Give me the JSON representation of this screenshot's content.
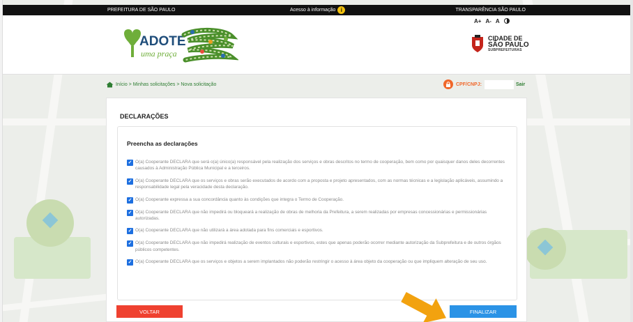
{
  "topbar": {
    "left": "PREFEITURA DE SÃO PAULO",
    "center": "Acesso à informação",
    "right": "TRANSPARÊNCIA SÃO PAULO"
  },
  "header": {
    "brand_main": "ADOTE",
    "brand_sub": "uma praça",
    "font_controls": [
      "A+",
      "A-",
      "A"
    ],
    "city_line1": "CIDADE DE",
    "city_line2": "SÃO PAULO",
    "city_line3": "SUBPREFEITURAS"
  },
  "breadcrumb": {
    "text": "Início > Minhas solicitações > Nova solicitação",
    "cpf_label": "CPF/CNPJ:",
    "cpf_value": "",
    "logout": "Sair"
  },
  "card": {
    "title": "DECLARAÇÕES",
    "section_heading": "Preencha as declarações",
    "declarations": [
      {
        "text": "O(a) Cooperante DECLARA que será o(a) único(a) responsável pela realização dos serviços e obras descritos no termo de cooperação, bem como por quaisquer danos deles decorrentes causados à Administração Pública Municipal e a terceiros.",
        "checked": true
      },
      {
        "text": "O(a) Cooperante DECLARA que os serviços e obras serão executados de acordo com a proposta e projeto apresentados, com as normas técnicas e a legislação aplicáveis, assumindo a responsabilidade legal pela veracidade desta declaração.",
        "checked": true
      },
      {
        "text": "O(a) Cooperante expressa a sua concordância quanto às condições que integra o Termo de Cooperação.",
        "checked": true
      },
      {
        "text": "O(a) Cooperante DECLARA que não impedirá ou bloqueará a realização de obras de melhoria da Prefeitura, a serem realizadas por empresas concessionárias e permissionárias autorizadas.",
        "checked": true
      },
      {
        "text": "O(a) Cooperante DECLARA que não utilizará a área adotada para fins comerciais e esportivos.",
        "checked": true
      },
      {
        "text": "O(a) Cooperante DECLARA que não impedirá realização de eventos culturais e esportivos, estes que apenas poderão ocorrer mediante autorização da Subprefeitura e de outros órgãos públicos competentes.",
        "checked": true
      },
      {
        "text": "O(a) Cooperante DECLARA que os serviços e objetos a serem implantados não poderão restringir o acesso à área objeto da cooperação ou que impliquem alteração de seu uso.",
        "checked": true
      }
    ]
  },
  "buttons": {
    "back": "VOLTAR",
    "finish": "FINALIZAR"
  },
  "colors": {
    "back_button": "#ef4130",
    "finish_button": "#2b93e6",
    "checkbox": "#1d6fe0",
    "accent_orange": "#f0672a",
    "link_green": "#2e7d32"
  }
}
